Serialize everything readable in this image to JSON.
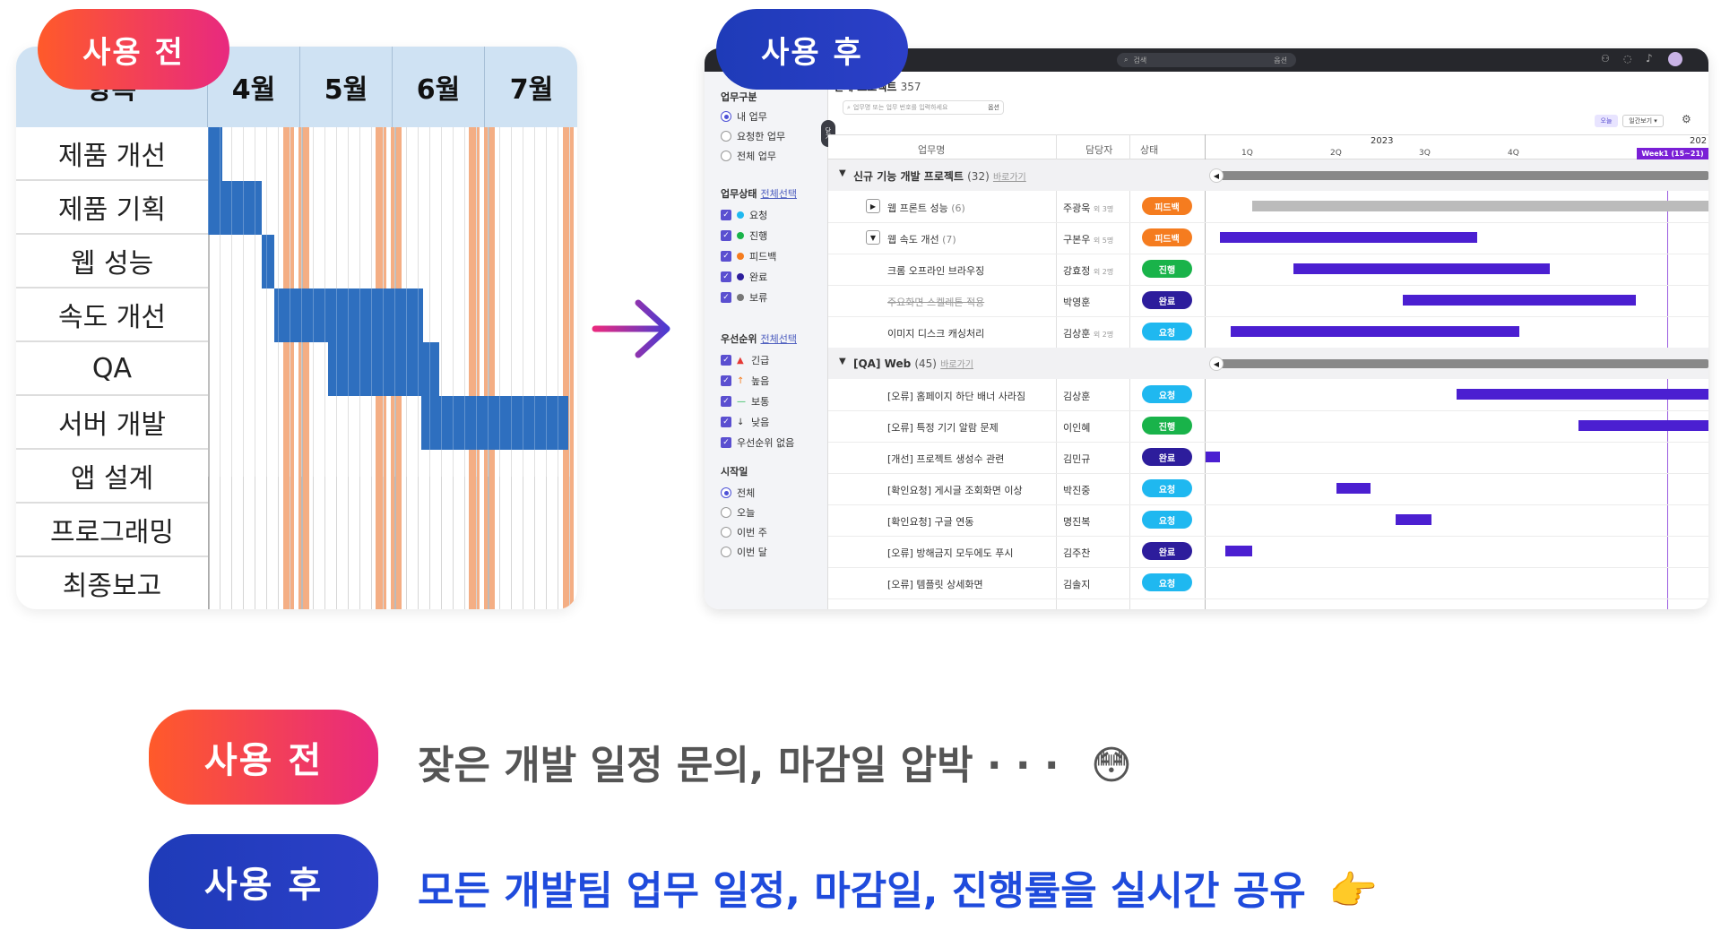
{
  "before_badge": "사용 전",
  "after_badge": "사용 후",
  "left_gantt": {
    "header_first": "항목",
    "months": [
      "4월",
      "5월",
      "6월",
      "7월"
    ],
    "rows": [
      "제품 개선",
      "제품 기획",
      "웹 성능",
      "속도 개선",
      "QA",
      "서버 개발",
      "앱 설계",
      "프로그래밍",
      "최종보고"
    ],
    "colors": {
      "header": "#cfe2f3",
      "bar": "#2e6fbf",
      "weekend": "#f4ae84"
    }
  },
  "app": {
    "search_placeholder": "검색",
    "search_hint": "옵션",
    "project_title": "전체 프로젝트",
    "project_count": "357",
    "task_search_placeholder": "업무명 또는 업무 번호를 입력하세요",
    "task_search_button": "옵션",
    "today_button": "오늘",
    "view_select": "일간보기 ▾",
    "sidebar_toggle": "닫기",
    "sidebar": {
      "group1_title": "업무구분",
      "group1_items": [
        "내 업무",
        "요청한 업무",
        "전체 업무"
      ],
      "group2_title": "업무상태",
      "group2_link": "전체선택",
      "group2_items": [
        {
          "label": "요청",
          "color": "#1fb8f0"
        },
        {
          "label": "진행",
          "color": "#19b34a"
        },
        {
          "label": "피드백",
          "color": "#f57c1f"
        },
        {
          "label": "완료",
          "color": "#2d1d9c"
        },
        {
          "label": "보류",
          "color": "#777777"
        }
      ],
      "group3_title": "우선순위",
      "group3_link": "전체선택",
      "group3_items": [
        {
          "icon": "▲",
          "label": "긴급",
          "color": "#e53935"
        },
        {
          "icon": "↑",
          "label": "높음",
          "color": "#f57c1f"
        },
        {
          "icon": "—",
          "label": "보통",
          "color": "#19b34a"
        },
        {
          "icon": "↓",
          "label": "낮음",
          "color": "#333333"
        },
        {
          "icon": "",
          "label": "우선순위 없음",
          "color": "#333333"
        }
      ],
      "group4_title": "시작일",
      "group4_items": [
        "전체",
        "오늘",
        "이번 주",
        "이번 달"
      ]
    },
    "columns": {
      "task": "업무명",
      "assignee": "담당자",
      "status": "상태"
    },
    "timeline": {
      "year": "2023",
      "year_next": "202",
      "quarters": [
        "1Q",
        "2Q",
        "3Q",
        "4Q"
      ],
      "week_label": "Week1 (15~21)"
    },
    "groups": [
      {
        "name": "신규 기능 개발 프로젝트",
        "count": "(32)",
        "link": "바로가기"
      },
      {
        "name": "[QA] Web",
        "count": "(45)",
        "link": "바로가기"
      }
    ],
    "tasks": [
      {
        "name": "웹 프론트 성능",
        "sub": "(6)",
        "assignee": "주광욱",
        "extra": "외 3명",
        "status": "피드백",
        "color": "#f57c1f",
        "toggle": "▶"
      },
      {
        "name": "웹 속도 개선",
        "sub": "(7)",
        "assignee": "구본우",
        "extra": "외 5명",
        "status": "피드백",
        "color": "#f57c1f",
        "toggle": "▼"
      },
      {
        "name": "크롬 오프라인 브라우징",
        "sub": "",
        "assignee": "강효정",
        "extra": "외 2명",
        "status": "진행",
        "color": "#19b34a",
        "toggle": ""
      },
      {
        "name": "주요화면 스켈레톤 적용",
        "sub": "",
        "assignee": "박영훈",
        "extra": "",
        "status": "완료",
        "color": "#2d1d9c",
        "toggle": ""
      },
      {
        "name": "이미지 디스크 캐싱처리",
        "sub": "",
        "assignee": "김상훈",
        "extra": "외 2명",
        "status": "요청",
        "color": "#1fb8f0",
        "toggle": ""
      },
      {
        "name": "[오류] 홈페이지 하단 배너 사라짐",
        "sub": "",
        "assignee": "김상훈",
        "extra": "",
        "status": "요청",
        "color": "#1fb8f0",
        "toggle": ""
      },
      {
        "name": "[오류] 특정 기기 알람 문제",
        "sub": "",
        "assignee": "이인혜",
        "extra": "",
        "status": "진행",
        "color": "#19b34a",
        "toggle": ""
      },
      {
        "name": "[개선] 프로젝트 생성수 관련",
        "sub": "",
        "assignee": "김민규",
        "extra": "",
        "status": "완료",
        "color": "#2d1d9c",
        "toggle": ""
      },
      {
        "name": "[확인요청] 게시글 조회화면 이상",
        "sub": "",
        "assignee": "박진중",
        "extra": "",
        "status": "요청",
        "color": "#1fb8f0",
        "toggle": ""
      },
      {
        "name": "[확인요청] 구글 연동",
        "sub": "",
        "assignee": "명진복",
        "extra": "",
        "status": "요청",
        "color": "#1fb8f0",
        "toggle": ""
      },
      {
        "name": "[오류] 방해금지 모두에도 푸시",
        "sub": "",
        "assignee": "김주찬",
        "extra": "",
        "status": "완료",
        "color": "#2d1d9c",
        "toggle": ""
      },
      {
        "name": "[오류] 템플릿 상세화면",
        "sub": "",
        "assignee": "김솔지",
        "extra": "",
        "status": "요청",
        "color": "#1fb8f0",
        "toggle": ""
      }
    ]
  },
  "captions": {
    "before_text": "잦은 개발 일정 문의, 마감일 압박 · · ·",
    "before_emoji": "😳",
    "after_text": "모든 개발팀 업무 일정, 마감일, 진행률을 실시간 공유",
    "after_emoji": "👉"
  }
}
